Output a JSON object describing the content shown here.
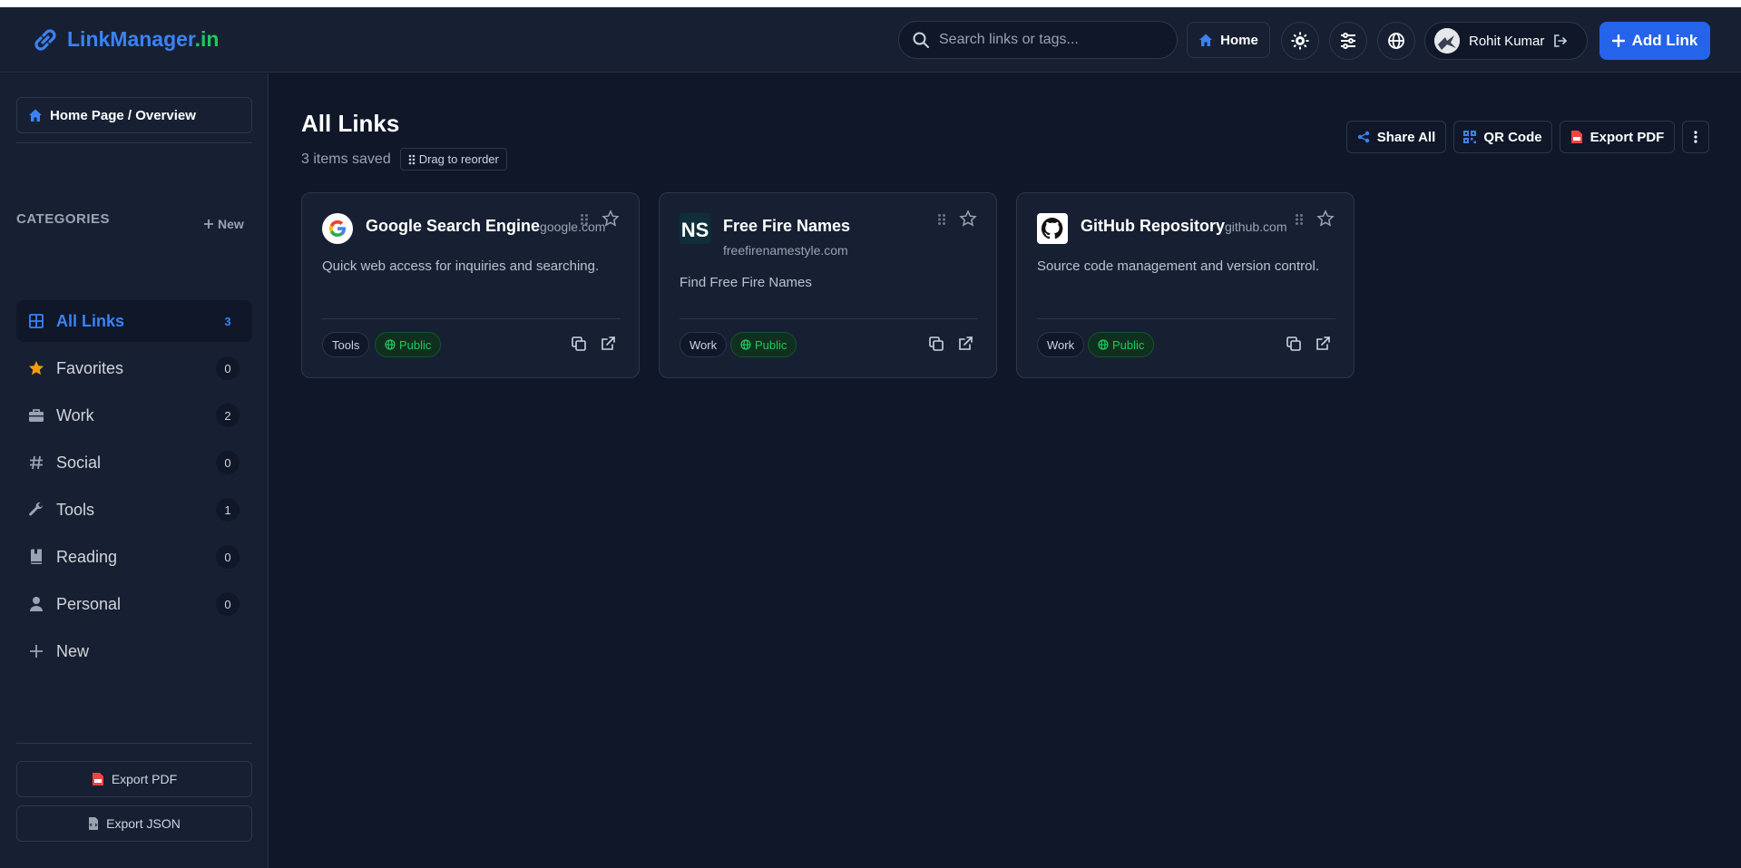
{
  "app": {
    "logo_part1": "LinkManager",
    "logo_part2": ".in"
  },
  "header": {
    "search_placeholder": "Search links or tags...",
    "home_label": "Home",
    "user_name": "Rohit Kumar",
    "add_link_label": "Add Link"
  },
  "sidebar": {
    "breadcrumb": "Home Page / Overview",
    "categories_title": "CATEGORIES",
    "new_label": "New",
    "items": [
      {
        "label": "All Links",
        "count": "3",
        "icon": "grid-icon"
      },
      {
        "label": "Favorites",
        "count": "0",
        "icon": "star-icon"
      },
      {
        "label": "Work",
        "count": "2",
        "icon": "briefcase-icon"
      },
      {
        "label": "Social",
        "count": "0",
        "icon": "hash-icon"
      },
      {
        "label": "Tools",
        "count": "1",
        "icon": "wrench-icon"
      },
      {
        "label": "Reading",
        "count": "0",
        "icon": "book-icon"
      },
      {
        "label": "Personal",
        "count": "0",
        "icon": "user-icon"
      },
      {
        "label": "New",
        "icon": "plus-icon"
      }
    ],
    "export_pdf": "Export PDF",
    "export_json": "Export JSON"
  },
  "main": {
    "title": "All Links",
    "items_saved": "3 items saved",
    "drag_hint": "Drag to reorder",
    "share_all": "Share All",
    "qr_code": "QR Code",
    "export_pdf": "Export PDF",
    "cards": [
      {
        "title": "Google Search Engine",
        "domain": "google.com",
        "description": "Quick web access for inquiries and searching.",
        "tag": "Tools",
        "visibility": "Public"
      },
      {
        "title": "Free Fire Names",
        "domain": "freefirenamestyle.com",
        "description": "Find Free Fire Names",
        "tag": "Work",
        "visibility": "Public"
      },
      {
        "title": "GitHub Repository",
        "domain": "github.com",
        "description": "Source code management and version control.",
        "tag": "Work",
        "visibility": "Public"
      }
    ]
  },
  "colors": {
    "accent": "#2563eb",
    "brand_green": "#22c55e",
    "background": "#0f1729",
    "panel": "#172032"
  }
}
